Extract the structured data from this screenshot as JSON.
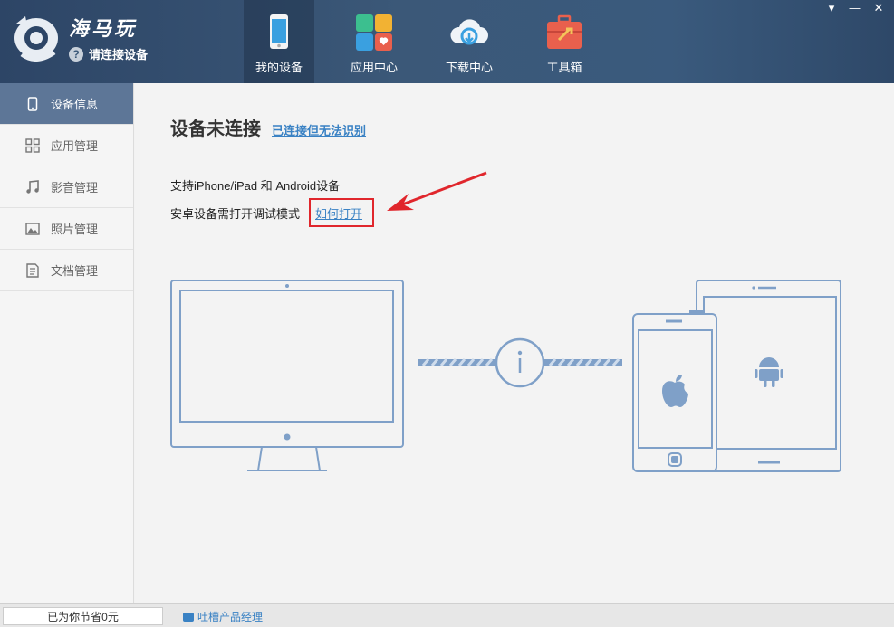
{
  "app": {
    "name": "海马玩",
    "connection_status": "请连接设备"
  },
  "nav": [
    {
      "label": "我的设备",
      "icon": "phone-device-icon"
    },
    {
      "label": "应用中心",
      "icon": "app-grid-icon"
    },
    {
      "label": "下载中心",
      "icon": "cloud-download-icon"
    },
    {
      "label": "工具箱",
      "icon": "toolbox-icon"
    }
  ],
  "window_buttons": {
    "dropdown": "▾",
    "minimize": "—",
    "close": "✕"
  },
  "sidebar": {
    "items": [
      {
        "label": "设备信息",
        "icon": "phone-icon"
      },
      {
        "label": "应用管理",
        "icon": "grid-icon"
      },
      {
        "label": "影音管理",
        "icon": "music-note-icon"
      },
      {
        "label": "照片管理",
        "icon": "picture-icon"
      },
      {
        "label": "文档管理",
        "icon": "document-icon"
      }
    ]
  },
  "main": {
    "title": "设备未连接",
    "title_link": "已连接但无法识别",
    "line1": "支持iPhone/iPad 和 Android设备",
    "line2": "安卓设备需打开调试模式",
    "howto_link": "如何打开"
  },
  "footer": {
    "saved_text": "已为你节省0元",
    "feedback_link": "吐槽产品经理"
  },
  "colors": {
    "header": "#3b5878",
    "sidebar_active": "#5d7697",
    "link": "#3a82c4",
    "highlight_box": "#e0262c",
    "illustration": "#7fa0c8"
  }
}
